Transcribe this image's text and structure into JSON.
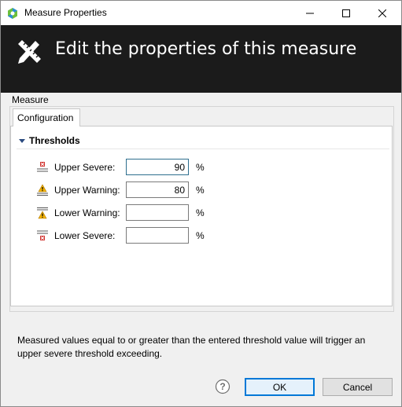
{
  "window": {
    "title": "Measure Properties"
  },
  "header": {
    "title": "Edit the properties of this measure"
  },
  "group": {
    "label": "Measure"
  },
  "tabs": [
    {
      "label": "Configuration",
      "selected": true
    }
  ],
  "thresholds": {
    "section_label": "Thresholds",
    "expanded": true,
    "rows": [
      {
        "label": "Upper Severe:",
        "value": "90",
        "unit": "%",
        "icon": "upper-severe-icon"
      },
      {
        "label": "Upper Warning:",
        "value": "80",
        "unit": "%",
        "icon": "upper-warning-icon"
      },
      {
        "label": "Lower Warning:",
        "value": "",
        "unit": "%",
        "icon": "lower-warning-icon"
      },
      {
        "label": "Lower Severe:",
        "value": "",
        "unit": "%",
        "icon": "lower-severe-icon"
      }
    ]
  },
  "info": {
    "text": "Measured values equal to or greater than the entered threshold value will trigger an upper severe threshold exceeding."
  },
  "buttons": {
    "ok": "OK",
    "cancel": "Cancel"
  },
  "colors": {
    "header_bg": "#1b1b1b",
    "ok_border": "#0078d7",
    "severe": "#d0312d",
    "warning": "#f5b400"
  }
}
